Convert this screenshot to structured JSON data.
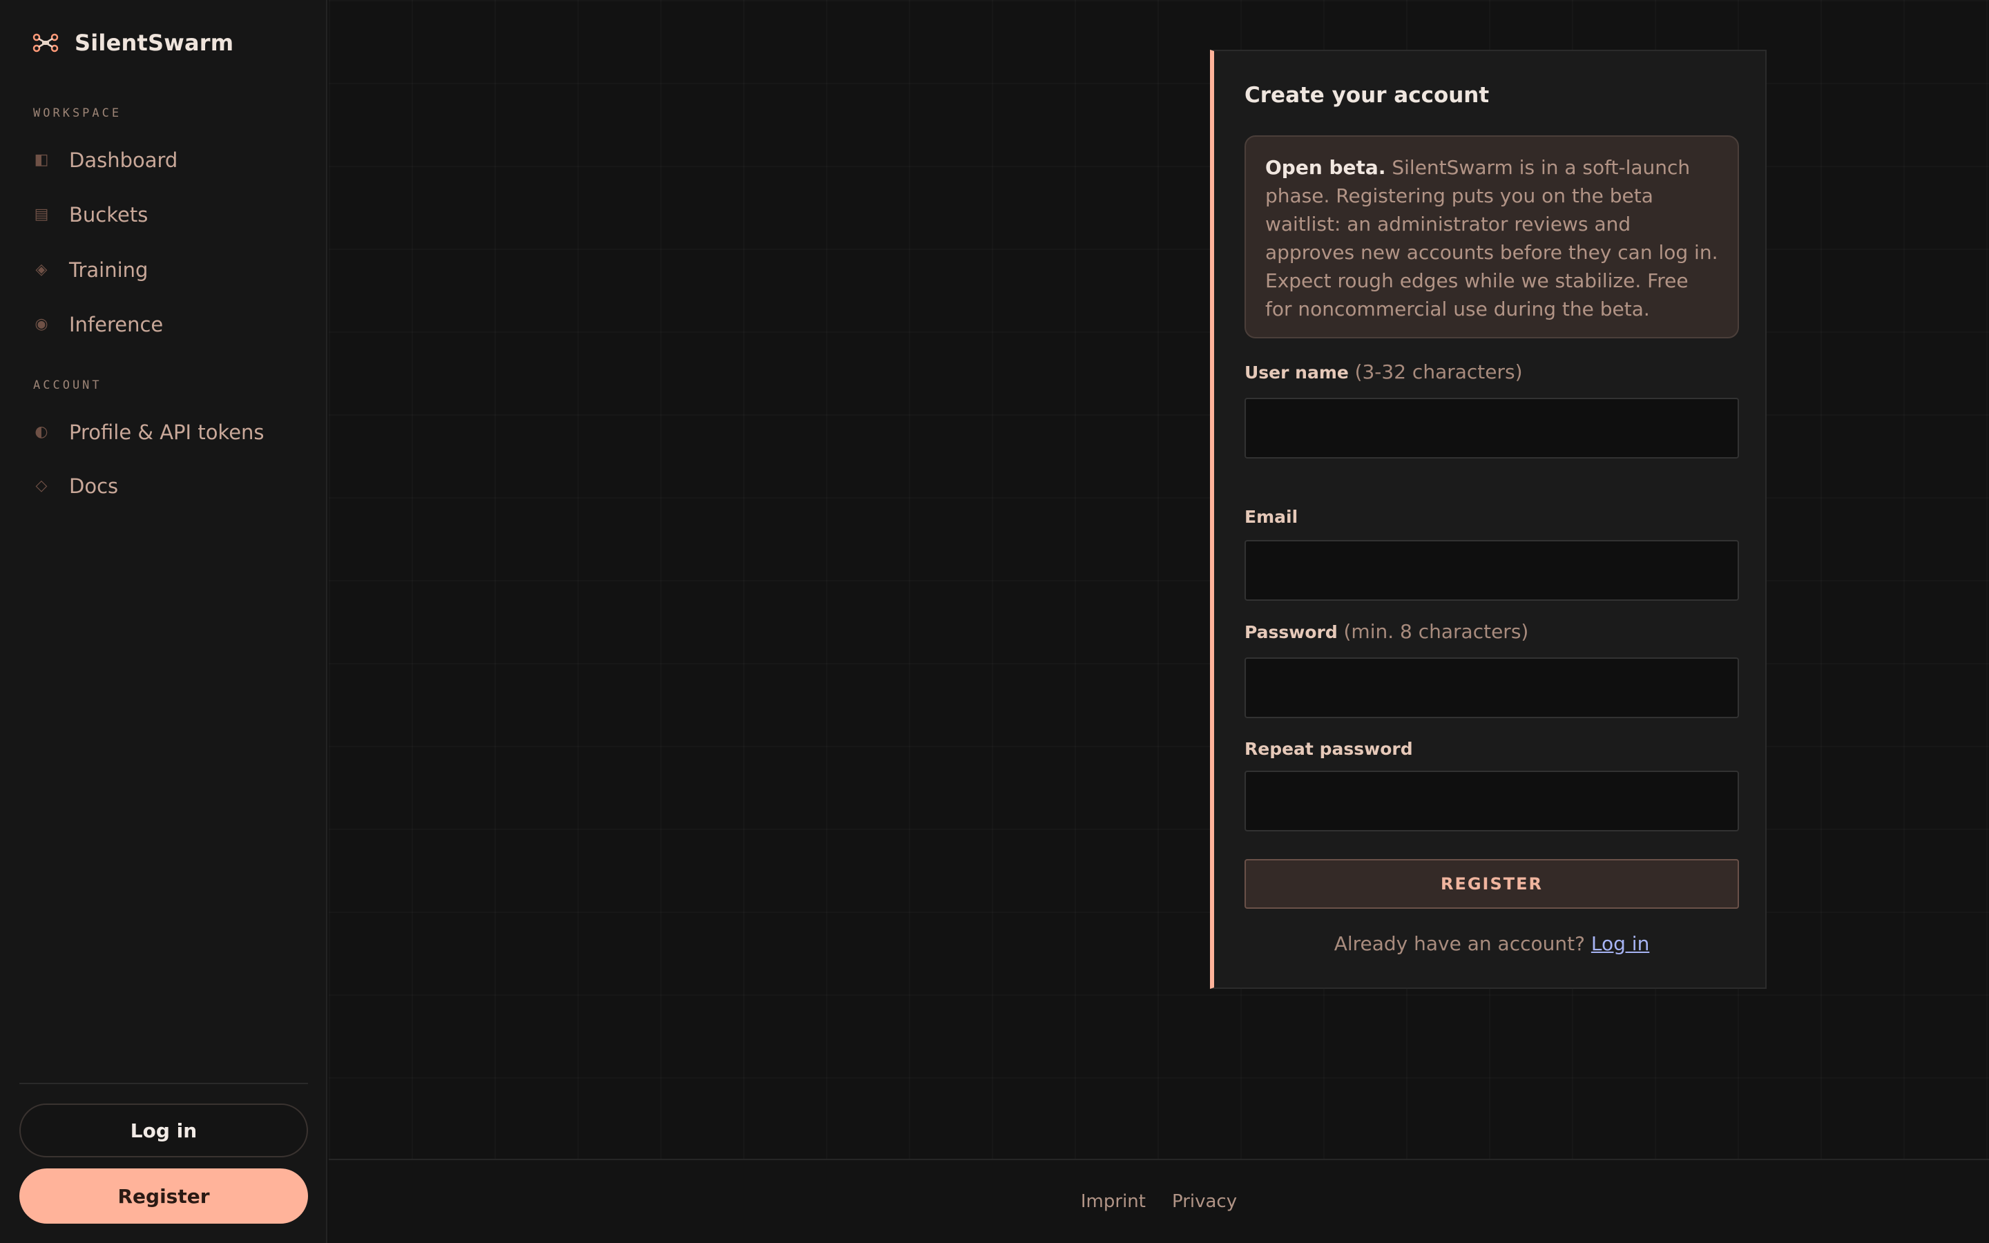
{
  "app": {
    "name": "SilentSwarm",
    "brand_icon": "drone-icon",
    "accent_color": "#ffb39a",
    "link_color": "#a7b4f5"
  },
  "sidebar": {
    "workspace_label": "WORKSPACE",
    "workspace_items": [
      {
        "label": "Dashboard",
        "icon": "dashboard-icon",
        "glyph": "◧"
      },
      {
        "label": "Buckets",
        "icon": "buckets-icon",
        "glyph": "▤"
      },
      {
        "label": "Training",
        "icon": "training-icon",
        "glyph": "◈"
      },
      {
        "label": "Inference",
        "icon": "inference-icon",
        "glyph": "◉"
      }
    ],
    "account_label": "ACCOUNT",
    "account_items": [
      {
        "label": "Profile & API tokens",
        "icon": "profile-icon",
        "glyph": "◐"
      },
      {
        "label": "Docs",
        "icon": "docs-icon",
        "glyph": "◇"
      }
    ],
    "login_label": "Log in",
    "register_label": "Register"
  },
  "form": {
    "title": "Create your account",
    "beta_strong": "Open beta.",
    "beta_text": " SilentSwarm is in a soft-launch phase. Registering puts you on the beta waitlist: an administrator reviews and approves new accounts before they can log in. Expect rough edges while we stabilize. Free for noncommercial use during the beta.",
    "username_label": "User name",
    "username_hint": "(3-32 characters)",
    "username_value": "",
    "email_label": "Email",
    "email_value": "",
    "password_label": "Password",
    "password_hint": "(min. 8 characters)",
    "password_value": "",
    "repeat_label": "Repeat password",
    "repeat_value": "",
    "submit_label": "REGISTER",
    "have_account_text": "Already have an account?",
    "login_link_label": "Log in"
  },
  "footer": {
    "links": [
      "Imprint",
      "Privacy"
    ]
  }
}
